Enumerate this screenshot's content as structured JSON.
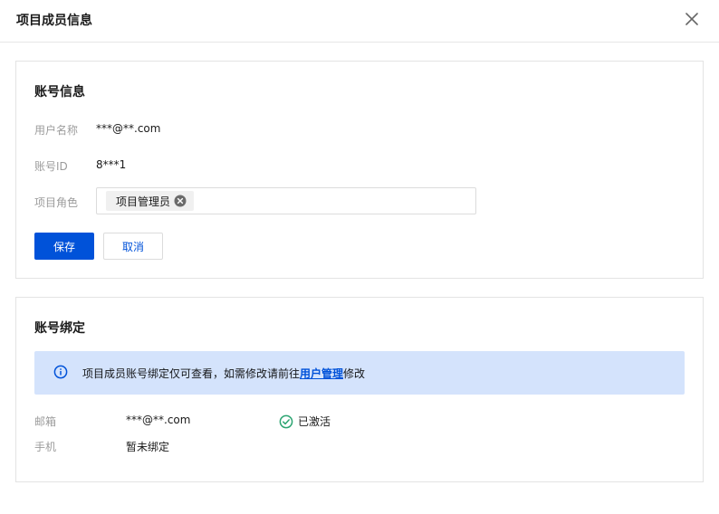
{
  "dialog": {
    "title": "项目成员信息",
    "close_icon": "close-icon"
  },
  "account_info": {
    "title": "账号信息",
    "username_label": "用户名称",
    "username_value": "***@**.com",
    "account_id_label": "账号ID",
    "account_id_value": "8***1",
    "role_label": "项目角色",
    "role_tag": "项目管理员",
    "save_label": "保存",
    "cancel_label": "取消"
  },
  "account_binding": {
    "title": "账号绑定",
    "notice": {
      "icon": "info-icon",
      "text_before": "项目成员账号绑定仅可查看，如需修改请前往",
      "link_text": "用户管理",
      "text_after": "修改"
    },
    "email_label": "邮箱",
    "email_value": "***@**.com",
    "email_status": "已激活",
    "email_status_icon": "check-circle-icon",
    "phone_label": "手机",
    "phone_value": "暂未绑定"
  },
  "colors": {
    "primary": "#0052d9",
    "notice_bg": "#d4e3fc",
    "success": "#2ba471"
  }
}
